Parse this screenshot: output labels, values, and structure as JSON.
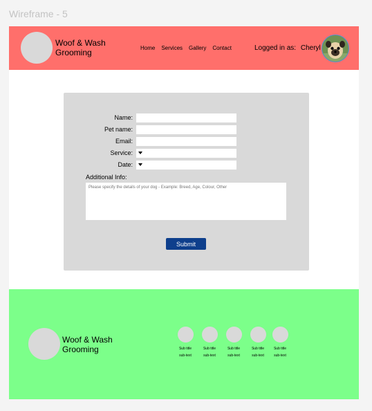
{
  "frame_label": "Wireframe - 5",
  "header": {
    "brand": "Woof & Wash Grooming",
    "nav": [
      "Home",
      "Services",
      "Gallery",
      "Contact"
    ],
    "logged_in_label": "Logged in as:",
    "user_name": "Cheryl",
    "colors": {
      "header_bg": "#ff6f6b"
    }
  },
  "form": {
    "name_label": "Name:",
    "pet_name_label": "Pet name:",
    "email_label": "Email:",
    "service_label": "Service:",
    "date_label": "Date:",
    "additional_label": "Additional Info:",
    "additional_placeholder": "Please specify the details of your dog - Example: Breed, Age, Colour, Other",
    "submit_label": "Submit",
    "colors": {
      "card_bg": "#d9d9d9",
      "submit_bg": "#0e3f8c"
    }
  },
  "footer": {
    "brand": "Woof & Wash Grooming",
    "items": [
      {
        "title": "Sub title",
        "sub": "sub-text"
      },
      {
        "title": "Sub title",
        "sub": "sub-text"
      },
      {
        "title": "Sub title",
        "sub": "sub-text"
      },
      {
        "title": "Sub title",
        "sub": "sub-text"
      },
      {
        "title": "Sub title",
        "sub": "sub-text"
      }
    ],
    "colors": {
      "footer_bg": "#7cff8a"
    }
  }
}
